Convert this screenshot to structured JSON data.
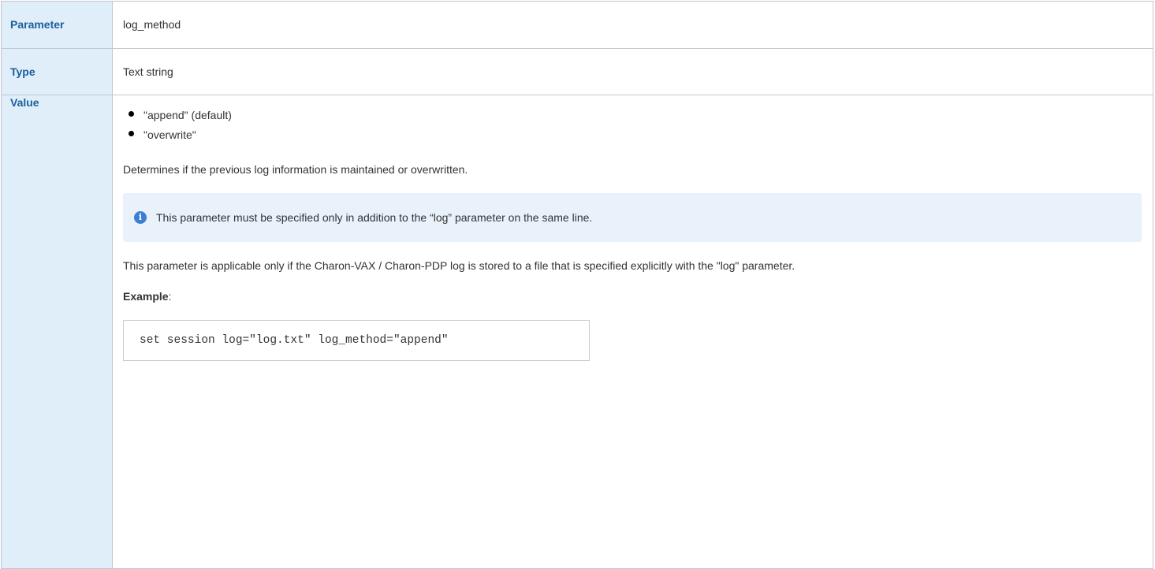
{
  "rows": {
    "parameter": {
      "label": "Parameter",
      "value": "log_method"
    },
    "type": {
      "label": "Type",
      "value": "Text string"
    },
    "value": {
      "label": "Value",
      "options": [
        "\"append\" (default)",
        "\"overwrite\""
      ],
      "description": "Determines if the previous log information is maintained or overwritten.",
      "note": "This parameter must be specified only in addition to the “log” parameter on the same line.",
      "applicability": "This parameter is applicable only if the Charon-VAX / Charon-PDP log is stored to a file that is specified explicitly with the \"log\" parameter.",
      "example_label": "Example",
      "example_suffix": ":",
      "example_code": "set session log=\"log.txt\" log_method=\"append\""
    }
  },
  "icons": {
    "info": "info-circle-icon",
    "info_glyph": "i",
    "bullet": "bullet-dot-icon"
  },
  "colors": {
    "header_bg": "#e0eefa",
    "header_text": "#1c5f9c",
    "border": "#c1c7d0",
    "info_bg": "#e9f1fb",
    "info_icon": "#3b7fd4"
  }
}
